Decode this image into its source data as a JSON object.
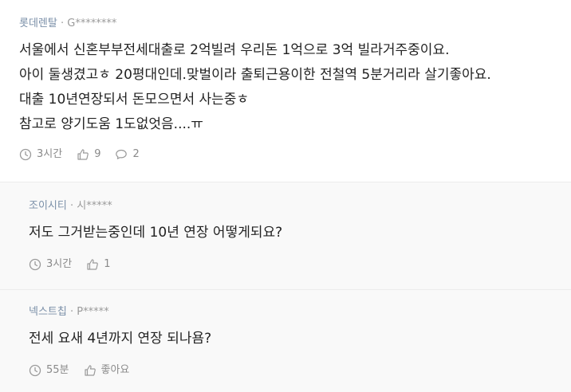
{
  "comments": [
    {
      "author": "롯데렌탈",
      "separator": "·",
      "user_id": "G********",
      "lines": [
        "서울에서 신혼부부전세대출로 2억빌려 우리돈 1억으로 3억 빌라거주중이요.",
        "아이 둘생겼고ㅎ 20평대인데.맞벌이라 출퇴근용이한 전철역 5분거리라 살기좋아요.",
        "대출 10년연장되서 돈모으면서 사는중ㅎ",
        "참고로 양기도움 1도없엇음....ㅠ"
      ],
      "time": "3시간",
      "likes": "9",
      "replies": "2"
    }
  ],
  "replies": [
    {
      "author": "조이시티",
      "separator": "·",
      "user_id": "시*****",
      "text": "저도 그거받는중인데 10년 연장 어떻게되요?",
      "time": "3시간",
      "likes": "1"
    },
    {
      "author": "넥스트칩",
      "separator": "·",
      "user_id": "P*****",
      "text": "전세 요새 4년까지 연장 되나욤?",
      "time": "55분",
      "likes": "좋아요"
    }
  ],
  "icons": {
    "clock": "clock-icon",
    "like": "thumbs-up-icon",
    "reply": "speech-bubble-icon"
  },
  "colors": {
    "author": "#7a8fa8",
    "meta": "#9a9a9a",
    "reply_bg": "#f9f9f9"
  }
}
